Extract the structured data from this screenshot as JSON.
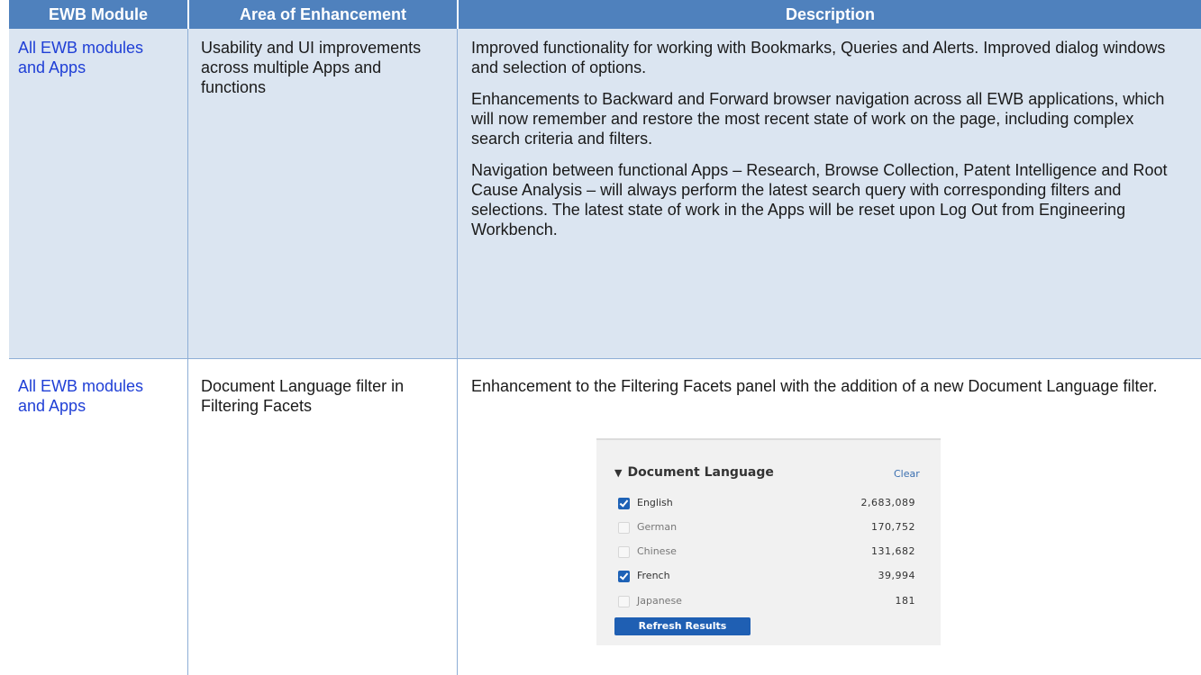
{
  "table": {
    "headers": [
      "EWB Module",
      "Area of Enhancement",
      "Description"
    ],
    "rows": [
      {
        "module": "All EWB modules and Apps",
        "area": "Usability and UI improvements across multiple Apps and functions",
        "description": [
          "Improved functionality for working with Bookmarks, Queries and Alerts. Improved dialog windows and selection of options.",
          "Enhancements to Backward and Forward browser navigation across all EWB applications, which will now remember and restore the most recent state of work on the page, including complex search criteria and filters.",
          "Navigation between functional Apps – Research, Browse Collection, Patent Intelligence and Root Cause Analysis – will always perform the latest search query with corresponding filters and selections. The latest state of work in the Apps will be reset upon Log Out from Engineering Workbench."
        ]
      },
      {
        "module": "All EWB modules and Apps",
        "area": "Document Language filter in Filtering Facets",
        "description": [
          "Enhancement to the Filtering Facets panel with the addition of a new Document Language filter."
        ]
      }
    ]
  },
  "facet_panel": {
    "title": "Document Language",
    "clear_label": "Clear",
    "items": [
      {
        "name": "English",
        "count": "2,683,089",
        "checked": true
      },
      {
        "name": "German",
        "count": "170,752",
        "checked": false
      },
      {
        "name": "Chinese",
        "count": "131,682",
        "checked": false
      },
      {
        "name": "French",
        "count": "39,994",
        "checked": true
      },
      {
        "name": "Japanese",
        "count": "181",
        "checked": false
      }
    ],
    "refresh_label": "Refresh Results"
  },
  "colors": {
    "header_bg": "#4f81bd",
    "row_alt_bg": "#dbe5f1",
    "module_text": "#1f3fd6",
    "checkbox_checked": "#1e62b6",
    "button_bg": "#1f5fb3"
  }
}
